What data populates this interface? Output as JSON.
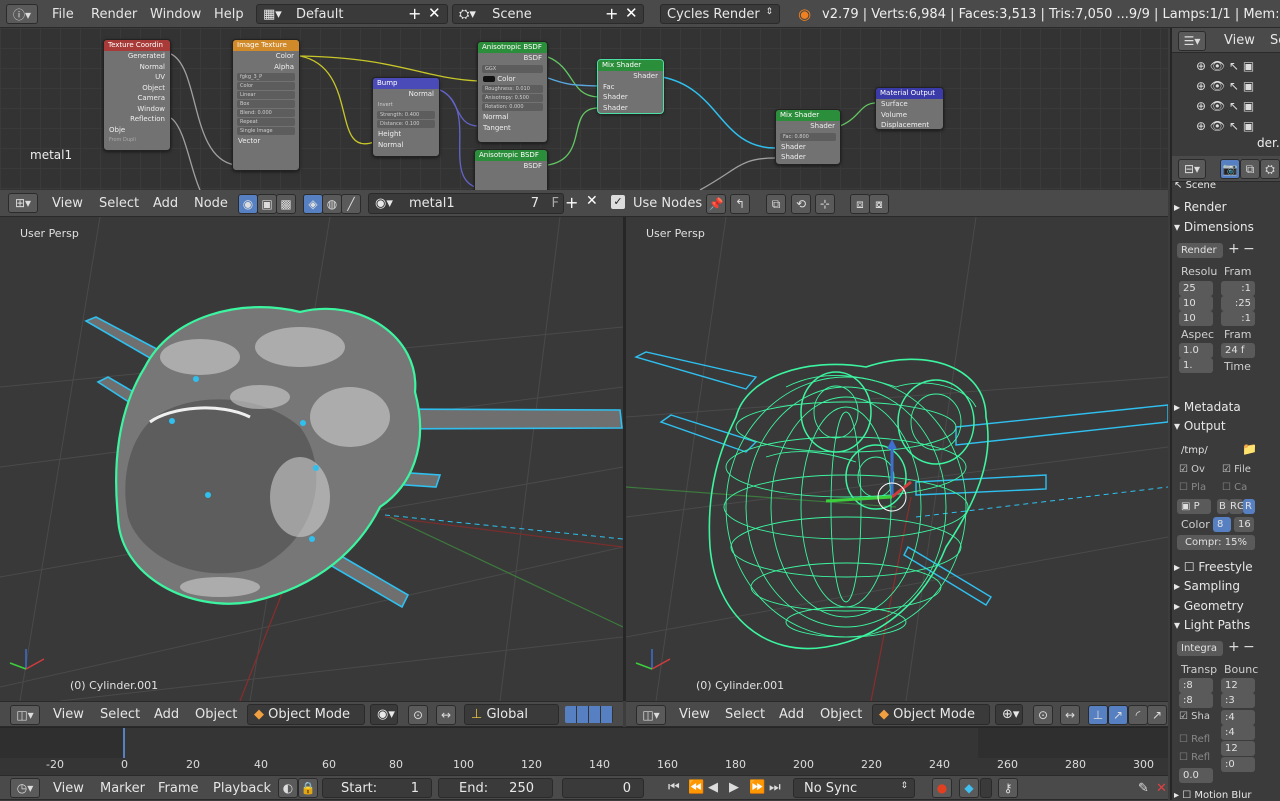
{
  "top_bar": {
    "menus": [
      "File",
      "Render",
      "Window",
      "Help"
    ],
    "layout": "Default",
    "scene": "Scene",
    "engine": "Cycles Render",
    "stats": "v2.79 | Verts:6,984 | Faces:3,513 | Tris:7,050 ...9/9 | Lamps:1/1 | Mem:43."
  },
  "node_editor": {
    "material_label": "metal1",
    "nodes": {
      "texcoord": {
        "title": "Texture Coordin",
        "outputs": [
          "Generated",
          "Normal",
          "UV",
          "Object",
          "Camera",
          "Window",
          "Reflection"
        ],
        "object_label": "Obje",
        "from_dupli": "From Dupli"
      },
      "image": {
        "title": "Image Texture",
        "outputs": [
          "Color",
          "Alpha"
        ],
        "image_name": "fgkg_3_P",
        "fields": [
          "Color",
          "Linear",
          "Box",
          "Blend:",
          "Repeat",
          "Single Image"
        ],
        "blend_value": "0.000",
        "input": "Vector"
      },
      "bump": {
        "title": "Bump",
        "output": "Normal",
        "invert": "Invert",
        "strength": "Strength:",
        "strength_value": "0.400",
        "distance": "Distance:",
        "distance_value": "0.100",
        "inputs": [
          "Height",
          "Normal"
        ]
      },
      "aniso1": {
        "title": "Anisotropic BSDF",
        "output": "BSDF",
        "dist": "GGX",
        "color": "Color",
        "fields": [
          "Roughness:",
          "Anisotropy:",
          "Rotation:"
        ],
        "values": [
          "0.010",
          "0.500",
          "0.000"
        ],
        "inputs": [
          "Normal",
          "Tangent"
        ]
      },
      "aniso2": {
        "title": "Anisotropic BSDF",
        "output": "BSDF"
      },
      "mix1": {
        "title": "Mix Shader",
        "output": "Shader",
        "inputs": [
          "Fac",
          "Shader",
          "Shader"
        ]
      },
      "mix2": {
        "title": "Mix Shader",
        "output": "Shader",
        "fac": "Fac:",
        "fac_value": "0.800",
        "inputs": [
          "Shader",
          "Shader"
        ]
      },
      "output": {
        "title": "Material Output",
        "inputs": [
          "Surface",
          "Volume",
          "Displacement"
        ]
      }
    }
  },
  "node_header": {
    "menus": [
      "View",
      "Select",
      "Add",
      "Node"
    ],
    "material": "metal1",
    "users": "7",
    "fake_user": "F",
    "use_nodes": "Use Nodes"
  },
  "viewport_left": {
    "label": "User Persp",
    "object": "(0) Cylinder.001"
  },
  "viewport_right": {
    "label": "User Persp",
    "object": "(0) Cylinder.001"
  },
  "view3d_header_left": {
    "menus": [
      "View",
      "Select",
      "Add",
      "Object"
    ],
    "mode": "Object Mode",
    "orientation": "Global"
  },
  "view3d_header_right": {
    "menus": [
      "View",
      "Select",
      "Add",
      "Object"
    ],
    "mode": "Object Mode"
  },
  "outliner": {
    "view": "View",
    "search": "Se",
    "item": "der."
  },
  "properties": {
    "scene": "Scene",
    "render": "Render",
    "dimensions": "Dimensions",
    "render_preset": "Render",
    "resolution_label": "Resolu",
    "frame_label": "Fram",
    "res_values": [
      "25",
      "10",
      "10"
    ],
    "frame_values": [
      ":1",
      ":25",
      ":1"
    ],
    "aspect_label": "Aspec",
    "frame_rate_label": "Fram",
    "aspect_values": [
      "1.0",
      "1."
    ],
    "fps": "24 f",
    "time": "Time",
    "metadata": "Metadata",
    "output": "Output",
    "output_path": "/tmp/",
    "ov": "Ov",
    "file": "File",
    "pla": "Pla",
    "ca": "Ca",
    "format_short": "P",
    "color_modes": [
      "B",
      "RG",
      "R"
    ],
    "color_label": "Color",
    "color_depth": [
      "8",
      "16"
    ],
    "compression": "Compr: 15%",
    "freestyle": "Freestyle",
    "sampling": "Sampling",
    "geometry": "Geometry",
    "light_paths": "Light Paths",
    "integrator": "Integra",
    "transp_label": "Transp",
    "bounce_label": "Bounc",
    "transp_values": [
      ":8",
      ":8"
    ],
    "bounce_values": [
      "12",
      ":3",
      ":4",
      ":4",
      "12",
      ":0"
    ],
    "sha": "Sha",
    "refl": "Refl",
    "refr": "Refl",
    "filter": "0.0",
    "motion_blur": "Motion Blur"
  },
  "timeline": {
    "ticks": [
      "-20",
      "0",
      "20",
      "40",
      "60",
      "80",
      "100",
      "120",
      "140",
      "160",
      "180",
      "200",
      "220",
      "240",
      "260",
      "280",
      "300"
    ],
    "menus": [
      "View",
      "Marker",
      "Frame",
      "Playback"
    ],
    "start_label": "Start:",
    "start": "1",
    "end_label": "End:",
    "end": "250",
    "current": "0",
    "sync": "No Sync"
  },
  "colors": {
    "accent": "#5680c2",
    "wire": "#3cf5a0",
    "selected": "#2fc0f0"
  }
}
